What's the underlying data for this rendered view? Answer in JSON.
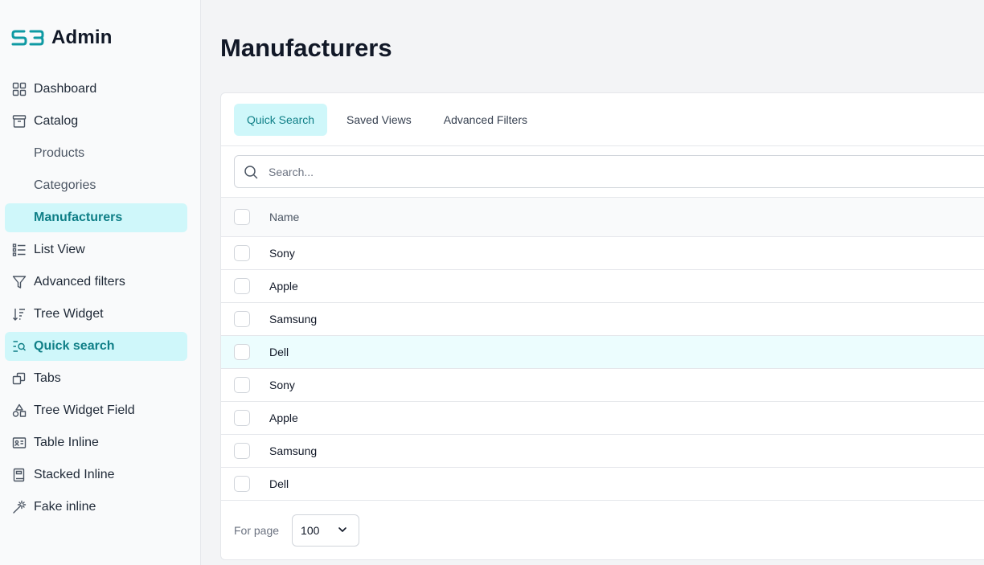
{
  "brand": {
    "mark": "SB",
    "name": "Admin",
    "color": "#0f9aa3"
  },
  "sidebar": {
    "items": [
      {
        "label": "Dashboard",
        "icon": "grid-icon"
      },
      {
        "label": "Catalog",
        "icon": "archive-icon"
      },
      {
        "label": "Products",
        "sub": true
      },
      {
        "label": "Categories",
        "sub": true
      },
      {
        "label": "Manufacturers",
        "sub": true,
        "active": true
      },
      {
        "label": "List View",
        "icon": "list-icon"
      },
      {
        "label": "Advanced filters",
        "icon": "filter-icon"
      },
      {
        "label": "Tree Widget",
        "icon": "sort-icon"
      },
      {
        "label": "Quick search",
        "icon": "search-list-icon",
        "active": true
      },
      {
        "label": "Tabs",
        "icon": "copy-icon"
      },
      {
        "label": "Tree Widget Field",
        "icon": "shapes-icon"
      },
      {
        "label": "Table Inline",
        "icon": "id-card-icon"
      },
      {
        "label": "Stacked Inline",
        "icon": "book-icon"
      },
      {
        "label": "Fake inline",
        "icon": "magic-wand-icon"
      }
    ]
  },
  "main": {
    "title": "Manufacturers",
    "tabs": [
      {
        "label": "Quick Search",
        "active": true
      },
      {
        "label": "Saved Views"
      },
      {
        "label": "Advanced Filters"
      }
    ],
    "search": {
      "placeholder": "Search...",
      "value": ""
    },
    "table": {
      "columns": [
        "Name"
      ],
      "rows": [
        "Sony",
        "Apple",
        "Samsung",
        "Dell",
        "Sony",
        "Apple",
        "Samsung",
        "Dell"
      ],
      "highlighted_row": 3
    },
    "pagination": {
      "label": "For page",
      "value": "100"
    }
  },
  "colors": {
    "accent": "#0f7f87",
    "accent_bg": "#cff7fa"
  }
}
